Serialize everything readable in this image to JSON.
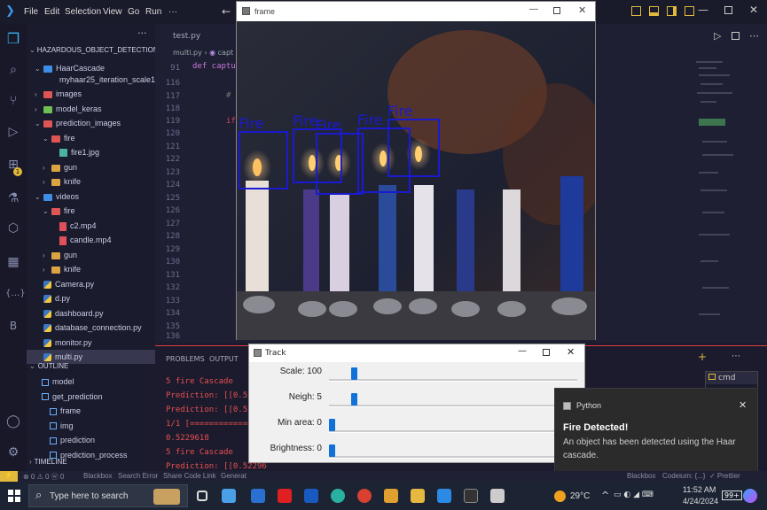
{
  "menu": [
    "File",
    "Edit",
    "Selection",
    "View",
    "Go",
    "Run",
    "···"
  ],
  "explorer": {
    "title": "HAZARDOUS_OBJECT_DETECTION",
    "more": "···",
    "items": [
      {
        "label": "HaarCascade",
        "type": "folder-open",
        "indent": 1
      },
      {
        "label": "myhaar25_iteration_scale1...",
        "type": "file",
        "indent": 3
      },
      {
        "label": "images",
        "type": "folder",
        "indent": 1
      },
      {
        "label": "model_keras",
        "type": "folder",
        "indent": 1
      },
      {
        "label": "prediction_images",
        "type": "folder-open",
        "indent": 1
      },
      {
        "label": "fire",
        "type": "folder-open",
        "indent": 2
      },
      {
        "label": "fire1.jpg",
        "type": "jpg",
        "indent": 3
      },
      {
        "label": "gun",
        "type": "folder",
        "indent": 2
      },
      {
        "label": "knife",
        "type": "folder",
        "indent": 2
      },
      {
        "label": "videos",
        "type": "folder-open",
        "indent": 1
      },
      {
        "label": "fire",
        "type": "folder-open",
        "indent": 2
      },
      {
        "label": "c2.mp4",
        "type": "mp4",
        "indent": 3
      },
      {
        "label": "candle.mp4",
        "type": "mp4",
        "indent": 3
      },
      {
        "label": "gun",
        "type": "folder",
        "indent": 2
      },
      {
        "label": "knife",
        "type": "folder",
        "indent": 2
      },
      {
        "label": "Camera.py",
        "type": "py",
        "indent": 1
      },
      {
        "label": "d.py",
        "type": "py",
        "indent": 1
      },
      {
        "label": "dashboard.py",
        "type": "py",
        "indent": 1
      },
      {
        "label": "database_connection.py",
        "type": "py",
        "indent": 1
      },
      {
        "label": "monitor.py",
        "type": "py",
        "indent": 1
      },
      {
        "label": "multi.py",
        "type": "py",
        "indent": 1,
        "selected": true
      }
    ],
    "outline_title": "OUTLINE",
    "outline": [
      {
        "label": "model",
        "indent": 1
      },
      {
        "label": "get_prediction",
        "indent": 1
      },
      {
        "label": "frame",
        "indent": 2
      },
      {
        "label": "img",
        "indent": 2
      },
      {
        "label": "prediction",
        "indent": 2
      },
      {
        "label": "prediction_process",
        "indent": 2
      }
    ],
    "timeline_title": "TIMELINE"
  },
  "editor": {
    "tab": "test.py",
    "breadcrumb_file": "multi.py",
    "breadcrumb_sym": "capt",
    "code_91": "def captur",
    "line_numbers": [
      "91",
      "116",
      "117",
      "118",
      "119",
      "120",
      "121",
      "122",
      "123",
      "124",
      "125",
      "126",
      "127",
      "128",
      "129",
      "130",
      "131",
      "132",
      "133",
      "134",
      "135",
      "136"
    ],
    "code_117": "#",
    "code_119": "if"
  },
  "frame_window": {
    "title": "frame",
    "detections": [
      {
        "label": "Fire"
      },
      {
        "label": "Fire"
      },
      {
        "label": "Fire"
      },
      {
        "label": "Fire"
      },
      {
        "label": "Fire"
      }
    ]
  },
  "panel": {
    "tabs": [
      "PROBLEMS",
      "OUTPUT"
    ],
    "lines": [
      "5 fire Cascade",
      "Prediction: [[0.520522",
      "Prediction: [[0.520522",
      "1/1 [==================",
      "0.5229618",
      "5 fire Cascade",
      "Prediction: [[0.52296",
      "Prediction: [[0.52296"
    ]
  },
  "track": {
    "title": "Track",
    "sliders": [
      {
        "label": "Scale: 100",
        "level": 0.09
      },
      {
        "label": "Neigh: 5",
        "level": 0.09
      },
      {
        "label": "Min area: 0",
        "level": 0.0
      },
      {
        "label": "Brightness: 0",
        "level": 0.0
      }
    ]
  },
  "toast": {
    "app": "Python",
    "title": "Fire Detected!",
    "body": "An object has been detected using the Haar cascade."
  },
  "status": {
    "left": "⊗ 0 ⚠ 0   ⓦ 0",
    "blackbox": "Blackbox",
    "search_error": "Search Error",
    "share": "Share Code Link",
    "generate": "Generat",
    "right_blackbox": "Blackbox",
    "codeium": "Codeium: {...}",
    "prettier": "✓ Prettier"
  },
  "taskbar": {
    "search_placeholder": "Type here to search",
    "weather": "29°C",
    "time": "11:52 AM",
    "date": "4/24/2024",
    "notif_count": "99+"
  },
  "panel_right": {
    "cmd": "cmd"
  }
}
